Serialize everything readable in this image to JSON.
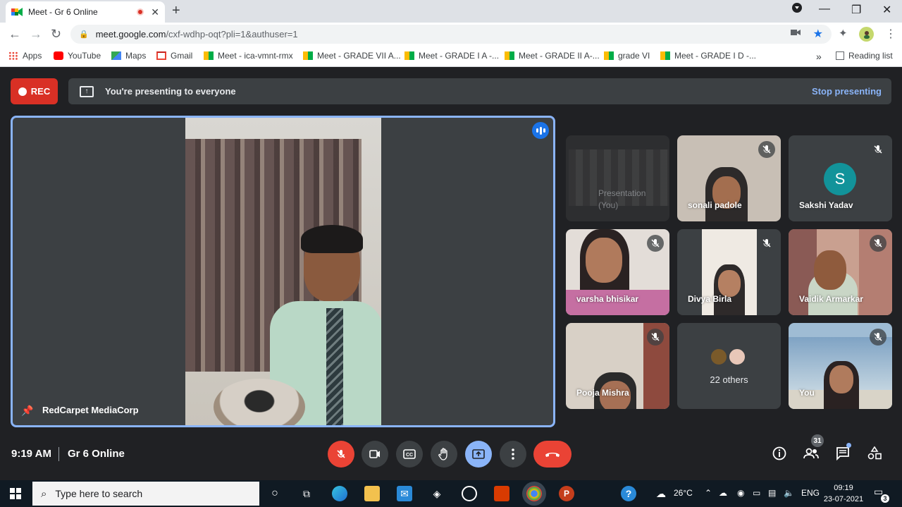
{
  "browser": {
    "tab_title": "Meet - Gr 6 Online",
    "new_tab": "+",
    "url_domain": "meet.google.com",
    "url_path": "/cxf-wdhp-oqt?pli=1&authuser=1",
    "bookmarks": [
      "Apps",
      "YouTube",
      "Maps",
      "Gmail",
      "Meet - ica-vmnt-rmx",
      "Meet - GRADE VII A...",
      "Meet - GRADE I A -...",
      "Meet - GRADE II A-...",
      "grade VI",
      "Meet - GRADE I D -..."
    ],
    "more_bookmarks": "»",
    "reading_list": "Reading list"
  },
  "meet": {
    "rec_label": "REC",
    "presenting_text": "You're presenting to everyone",
    "stop_presenting": "Stop presenting",
    "main_participant": "RedCarpet MediaCorp",
    "tiles": [
      {
        "name": "Presentation\n(You)"
      },
      {
        "name": "sonali padole"
      },
      {
        "name": "Sakshi Yadav",
        "initial": "S"
      },
      {
        "name": "varsha bhisikar"
      },
      {
        "name": "Divya Birla"
      },
      {
        "name": "Vaidik Armarkar"
      },
      {
        "name": "Pooja Mishra"
      },
      {
        "name": "22 others"
      },
      {
        "name": "You"
      }
    ],
    "time": "9:19 AM",
    "meeting_title": "Gr 6 Online",
    "participant_count": "31"
  },
  "taskbar": {
    "search_placeholder": "Type here to search",
    "temperature": "26°C",
    "language": "ENG",
    "time": "09:19",
    "date": "23-07-2021",
    "notifications": "3"
  },
  "colors": {
    "accent_blue": "#8ab4f8",
    "rec_red": "#d93025",
    "hangup_red": "#ea4335",
    "meet_bg": "#202124",
    "tile_bg": "#3c4043",
    "avatar_teal": "#12939a"
  }
}
